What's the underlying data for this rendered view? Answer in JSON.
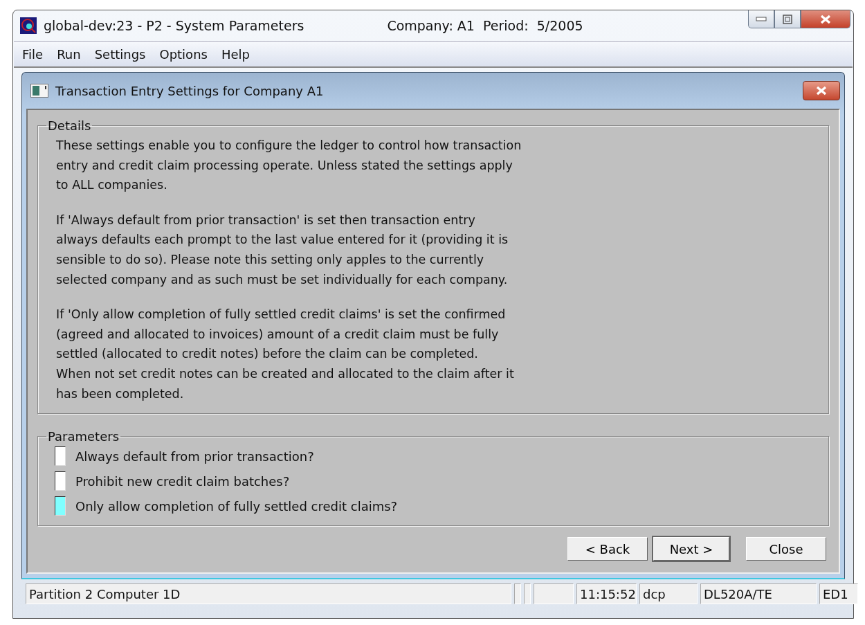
{
  "window": {
    "title": "global-dev:23 - P2 - System Parameters",
    "context": "Company: A1  Period:  5/2005"
  },
  "menu": [
    {
      "label": "File"
    },
    {
      "label": "Run"
    },
    {
      "label": "Settings"
    },
    {
      "label": "Options"
    },
    {
      "label": "Help"
    }
  ],
  "dialog": {
    "title": "Transaction Entry Settings for Company A1",
    "details": {
      "legend": "Details",
      "paragraphs": [
        "These settings enable you to configure the ledger to control how transaction\nentry and credit claim processing operate.  Unless stated the settings apply\nto ALL companies.",
        "If 'Always default from prior transaction' is set then transaction entry\nalways defaults each prompt to the last value entered for it (providing it is\nsensible to do so). Please note this setting only apples to the currently\nselected company and as such must be set individually for each company.",
        "If 'Only allow completion of fully settled credit claims' is set the confirmed\n(agreed and allocated to invoices) amount of a credit claim must be fully\nsettled (allocated to credit notes) before the claim can be completed.\nWhen not set credit notes can be created and allocated to the claim after it\nhas been completed."
      ]
    },
    "parameters": {
      "legend": "Parameters",
      "items": [
        {
          "label": "Always default from prior transaction?",
          "checked": false,
          "focused": false
        },
        {
          "label": "Prohibit new credit claim batches?",
          "checked": false,
          "focused": false
        },
        {
          "label": "Only allow completion of fully settled credit claims?",
          "checked": false,
          "focused": true
        }
      ]
    },
    "buttons": [
      {
        "label": "< Back",
        "default": false
      },
      {
        "label": "Next >",
        "default": true
      },
      {
        "label": "Close",
        "default": false
      }
    ]
  },
  "status_bar": [
    {
      "text": "Partition 2 Computer 1D",
      "kind": "wide"
    },
    {
      "kind": "tiny"
    },
    {
      "kind": "tiny"
    },
    {
      "kind": "blank"
    },
    {
      "text": "11:15:52",
      "kind": "normal"
    },
    {
      "text": "dcp",
      "kind": "normal"
    },
    {
      "text": "DL520A/TE",
      "kind": "long"
    },
    {
      "text": "ED1",
      "kind": "normal"
    }
  ]
}
